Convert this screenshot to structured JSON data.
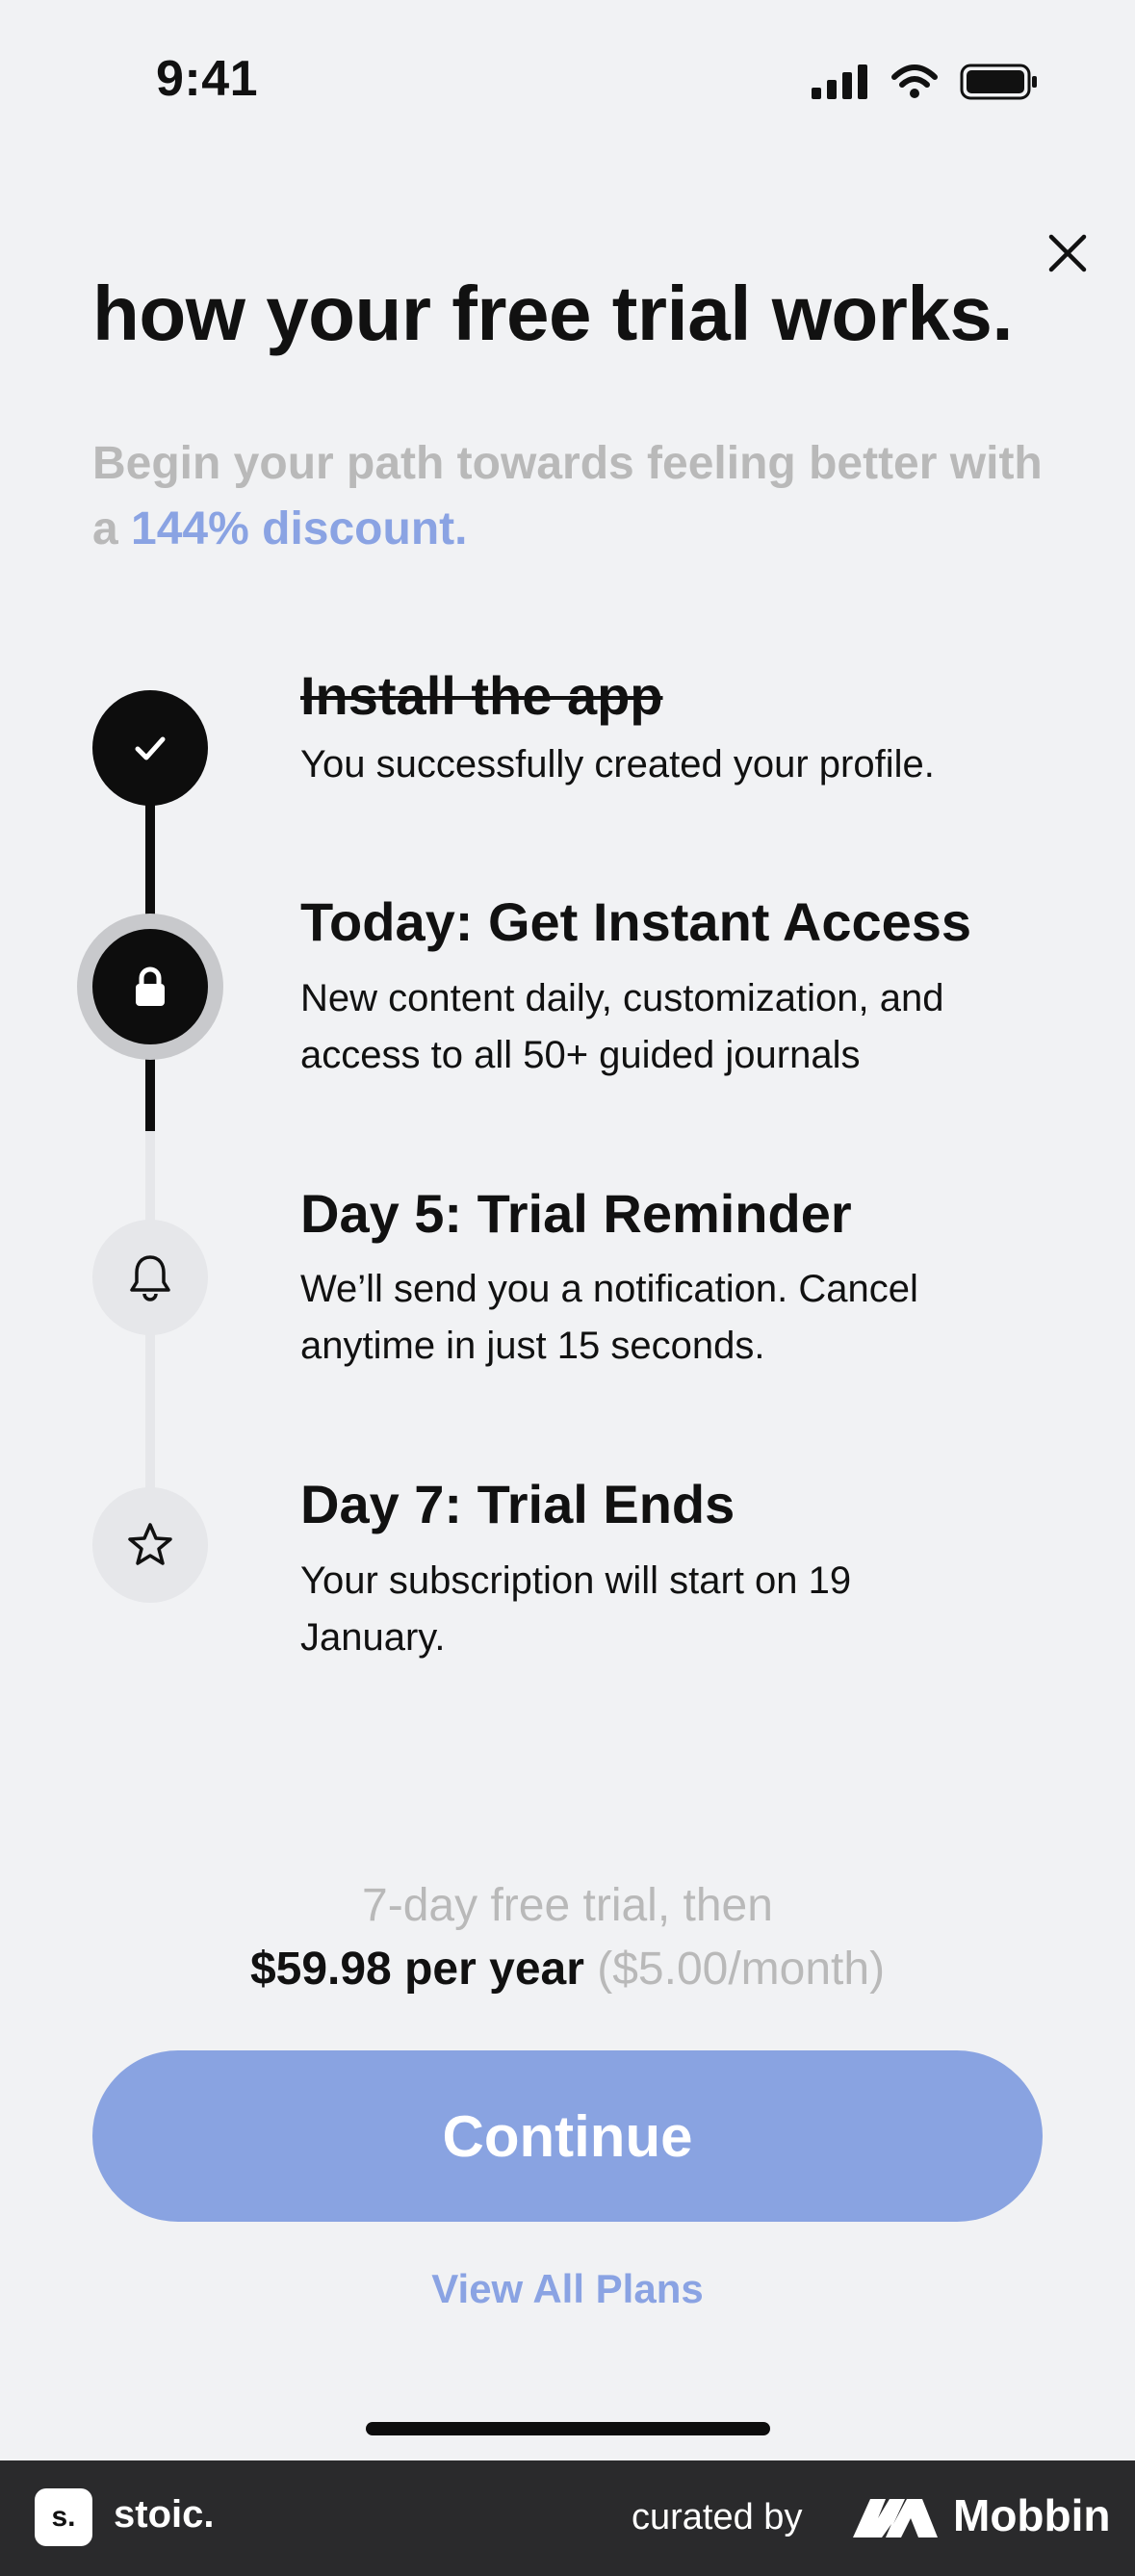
{
  "status_bar": {
    "time": "9:41",
    "icons": [
      "cellular-icon",
      "wifi-icon",
      "battery-icon"
    ]
  },
  "header": {
    "close_icon": "close-icon",
    "title": "how your free trial works.",
    "subtitle_prefix": "Begin your path towards feeling better with a ",
    "subtitle_accent": "144% discount."
  },
  "steps": [
    {
      "icon": "checkmark-icon",
      "title": "Install the app",
      "description": "You successfully created your profile.",
      "status": "done"
    },
    {
      "icon": "lock-icon",
      "title": "Today: Get Instant Access",
      "description": "New content daily, customization, and access to all 50+ guided journals",
      "status": "current"
    },
    {
      "icon": "bell-icon",
      "title": "Day 5: Trial Reminder",
      "description": "We’ll send you a notification. Cancel anytime in just 15 seconds.",
      "status": "upcoming"
    },
    {
      "icon": "star-icon",
      "title": "Day 7: Trial Ends",
      "description": "Your subscription will start on 19 January.",
      "status": "upcoming"
    }
  ],
  "pricing": {
    "trial_text": "7-day free trial, then",
    "price_text": "$59.98 per year",
    "monthly_text": "($5.00/month)"
  },
  "actions": {
    "continue_label": "Continue",
    "view_plans_label": "View All Plans"
  },
  "footer": {
    "app_logo": "s.",
    "app_name": "stoic.",
    "curated_by": "curated by",
    "brand": "Mobbin"
  },
  "colors": {
    "accent": "#89a3e1",
    "background": "#f1f2f4",
    "muted_text": "#b9b9b9",
    "dark": "#0d0d0d",
    "footer_bg": "#2a2a2c"
  }
}
